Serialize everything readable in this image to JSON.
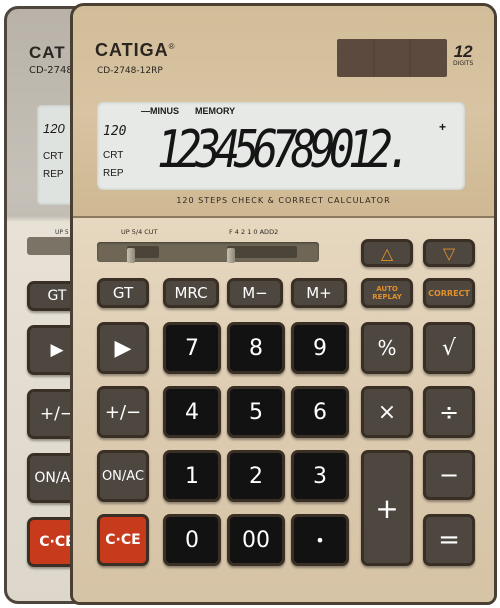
{
  "back_calculator": {
    "brand": "CAT",
    "model": "CD-2748",
    "lcd_indicators": [
      "120",
      "CRT",
      "REP"
    ],
    "slider_label": "UP 5",
    "keys": [
      "GT",
      "▶",
      "+/−",
      "ON/AC",
      "C·CE"
    ]
  },
  "calculator": {
    "brand": "CATIGA",
    "registered_mark": "®",
    "model": "CD-2748-12RP",
    "digits_badge": {
      "number": "12",
      "label": "DIGITS"
    },
    "display": {
      "top_indicators": [
        "—MINUS",
        "MEMORY"
      ],
      "left_indicators": [
        "120",
        "CRT",
        "REP"
      ],
      "readout": "123456789012.",
      "sign_indicator": "+"
    },
    "tagline": "120 STEPS CHECK & CORRECT CALCULATOR",
    "switches": {
      "rounding": {
        "labels": "UP  5/4  CUT",
        "selected": "UP"
      },
      "decimal": {
        "labels": "F   4   2   1   0   ADD2",
        "selected": "F"
      }
    },
    "keys": {
      "up": "△",
      "down": "▽",
      "gt": "GT",
      "mrc": "MRC",
      "m_minus": "M−",
      "m_plus": "M+",
      "auto_replay": "AUTO REPLAY",
      "correct": "CORRECT",
      "backspace": "▶",
      "seven": "7",
      "eight": "8",
      "nine": "9",
      "percent": "%",
      "sqrt": "√",
      "sign": "+/−",
      "four": "4",
      "five": "5",
      "six": "6",
      "multiply": "×",
      "divide": "÷",
      "on_ac": "ON/AC",
      "one": "1",
      "two": "2",
      "three": "3",
      "plus": "+",
      "minus": "−",
      "clear": "C·CE",
      "zero": "0",
      "double_zero": "00",
      "decimal": "•",
      "equals": "="
    },
    "colors": {
      "body_gold": "#d9c7a8",
      "key_dark": "#121212",
      "key_function": "#4d4740",
      "key_red": "#c83a1c",
      "accent_orange": "#e0902a",
      "lcd": "#e6e9e6"
    }
  }
}
